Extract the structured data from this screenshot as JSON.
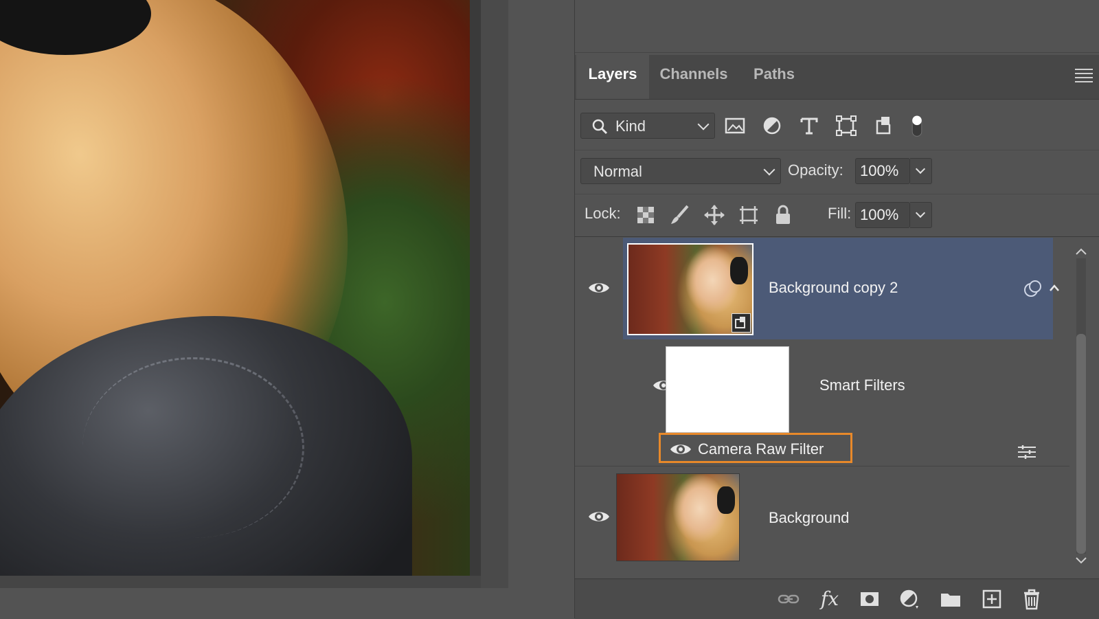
{
  "tabs": {
    "layers": "Layers",
    "channels": "Channels",
    "paths": "Paths"
  },
  "filter": {
    "kind_label": "Kind"
  },
  "blend": {
    "mode": "Normal",
    "opacity_label": "Opacity:",
    "opacity_value": "100%"
  },
  "lock": {
    "label": "Lock:",
    "fill_label": "Fill:",
    "fill_value": "100%"
  },
  "layers": [
    {
      "name": "Background copy 2",
      "visible": true,
      "selected": true,
      "smart_object": true
    },
    {
      "name": "Smart Filters",
      "visible": true
    },
    {
      "name": "Camera Raw Filter",
      "visible": true,
      "highlighted": true
    },
    {
      "name": "Background",
      "visible": true
    }
  ],
  "colors": {
    "panel_bg": "#535353",
    "selection": "#4c5a77",
    "highlight": "#e8892a"
  },
  "icons": [
    "search-icon",
    "image-filter-icon",
    "adjustment-filter-icon",
    "type-filter-icon",
    "shape-filter-icon",
    "smart-object-filter-icon",
    "filter-toggle-icon",
    "lock-pixels-icon",
    "lock-brush-icon",
    "lock-position-icon",
    "lock-artboard-icon",
    "lock-all-icon",
    "eye-icon",
    "link-icon",
    "fx-icon",
    "mask-icon",
    "adjustment-layer-icon",
    "folder-icon",
    "new-layer-icon",
    "trash-icon"
  ]
}
